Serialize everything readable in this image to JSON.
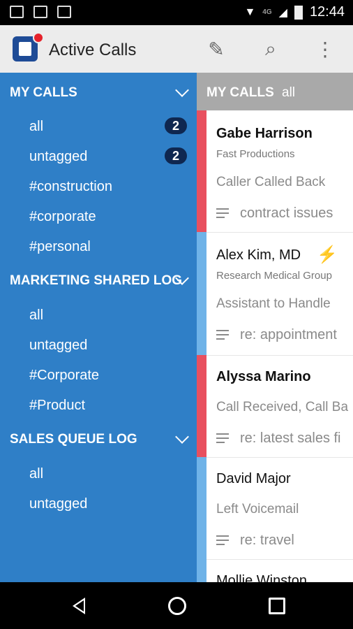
{
  "status_bar": {
    "time": "12:44",
    "network": "4G"
  },
  "app_bar": {
    "title": "Active Calls"
  },
  "sidebar": {
    "sections": [
      {
        "title": "MY CALLS",
        "items": [
          {
            "label": "all",
            "badge": "2"
          },
          {
            "label": "untagged",
            "badge": "2"
          },
          {
            "label": "#construction"
          },
          {
            "label": "#corporate"
          },
          {
            "label": "#personal"
          }
        ]
      },
      {
        "title": "MARKETING SHARED LOG",
        "items": [
          {
            "label": "all"
          },
          {
            "label": "untagged"
          },
          {
            "label": "#Corporate"
          },
          {
            "label": "#Product"
          }
        ]
      },
      {
        "title": "SALES QUEUE LOG",
        "items": [
          {
            "label": "all"
          },
          {
            "label": "untagged"
          }
        ]
      }
    ]
  },
  "panel": {
    "header": {
      "title": "MY CALLS",
      "filter": "all"
    },
    "calls": [
      {
        "name": "Gabe Harrison",
        "company": "Fast Productions",
        "status": "Caller Called Back",
        "note": "contract issues",
        "color": "#e8505f"
      },
      {
        "name": "Alex Kim, MD",
        "company": "Research Medical Group",
        "status": "Assistant to Handle",
        "note": "re: appointment",
        "color": "#6fb3e8"
      },
      {
        "name": "Alyssa Marino",
        "company": "",
        "status": "Call Received, Call Ba",
        "note": "re: latest sales fi",
        "color": "#e8505f"
      },
      {
        "name": "David Major",
        "company": "",
        "status": "Left Voicemail",
        "note": "re: travel",
        "color": "#6fb3e8"
      },
      {
        "name": "Mollie Winston",
        "company": "",
        "status": "",
        "note": "",
        "color": "#6fb3e8"
      }
    ]
  }
}
